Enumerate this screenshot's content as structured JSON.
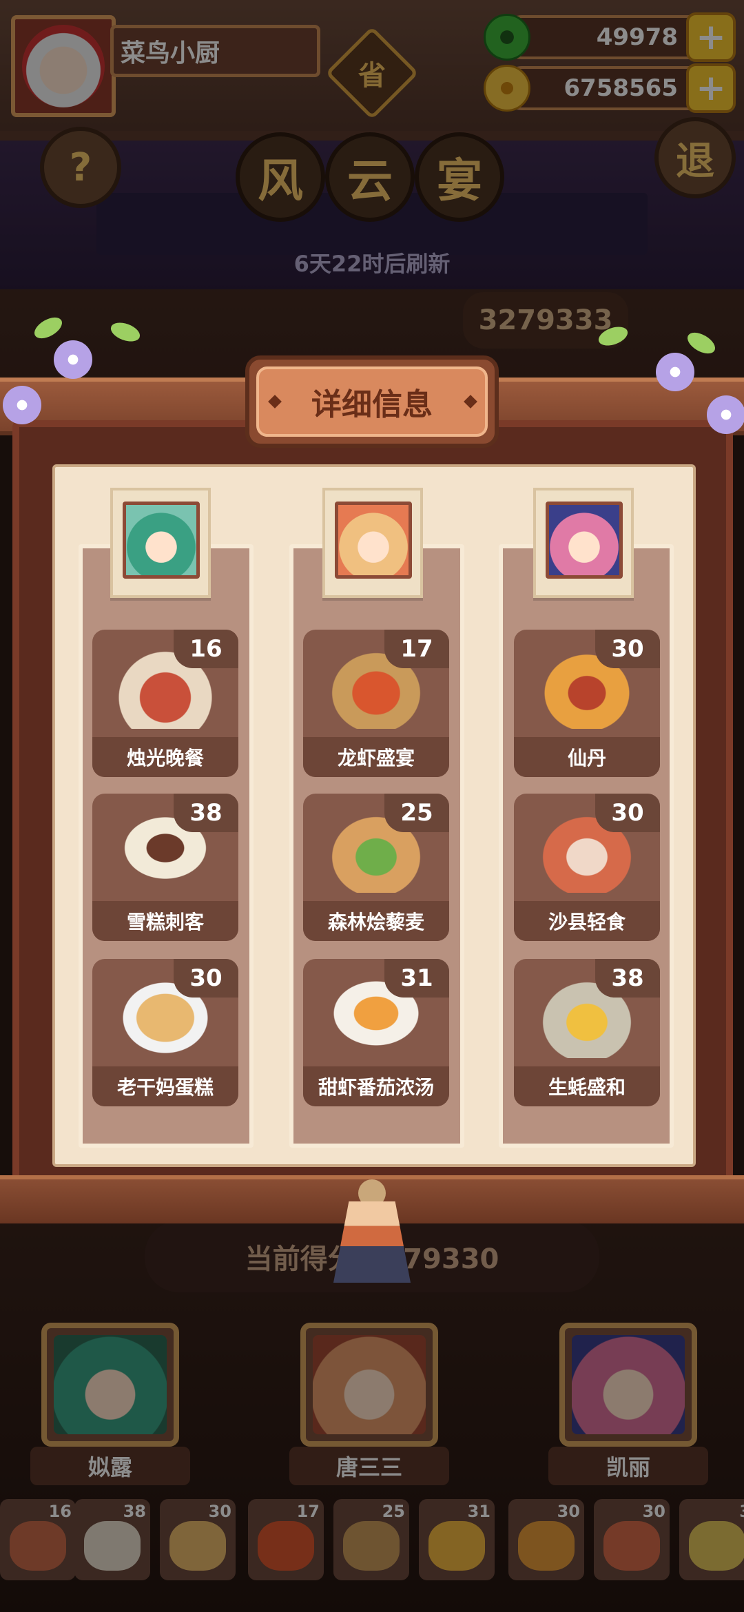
{
  "player": {
    "name": "菜鸟小厨"
  },
  "province_badge": "省",
  "currency": {
    "jade": "49978",
    "coins": "6758565",
    "add_symbol": "+"
  },
  "buttons": {
    "help": "?",
    "exit": "退"
  },
  "event": {
    "title_chars": [
      "风",
      "云",
      "宴"
    ],
    "refresh_text": "6天22时后刷新",
    "top_score": "3279333",
    "current_score_text": "当前得分 3279330"
  },
  "modal": {
    "title": "详细信息",
    "columns": [
      {
        "dishes": [
          {
            "name": "烛光晚餐",
            "count": "16"
          },
          {
            "name": "雪糕刺客",
            "count": "38"
          },
          {
            "name": "老干妈蛋糕",
            "count": "30"
          }
        ]
      },
      {
        "dishes": [
          {
            "name": "龙虾盛宴",
            "count": "17"
          },
          {
            "name": "森林烩藜麦",
            "count": "25"
          },
          {
            "name": "甜虾番茄浓汤",
            "count": "31"
          }
        ]
      },
      {
        "dishes": [
          {
            "name": "仙丹",
            "count": "30"
          },
          {
            "name": "沙县轻食",
            "count": "30"
          },
          {
            "name": "生蚝盛和",
            "count": "38"
          }
        ]
      }
    ]
  },
  "chefs": [
    {
      "name": "姒露"
    },
    {
      "name": "唐三三"
    },
    {
      "name": "凯丽"
    }
  ],
  "dish_strip": [
    "16",
    "38",
    "30",
    "17",
    "25",
    "31",
    "30",
    "30",
    "3"
  ],
  "colors": {
    "panel_bg": "#f3e3cc",
    "card_bg": "#85594a",
    "accent_gold": "#f7c830",
    "title_plate": "#d9895e"
  }
}
